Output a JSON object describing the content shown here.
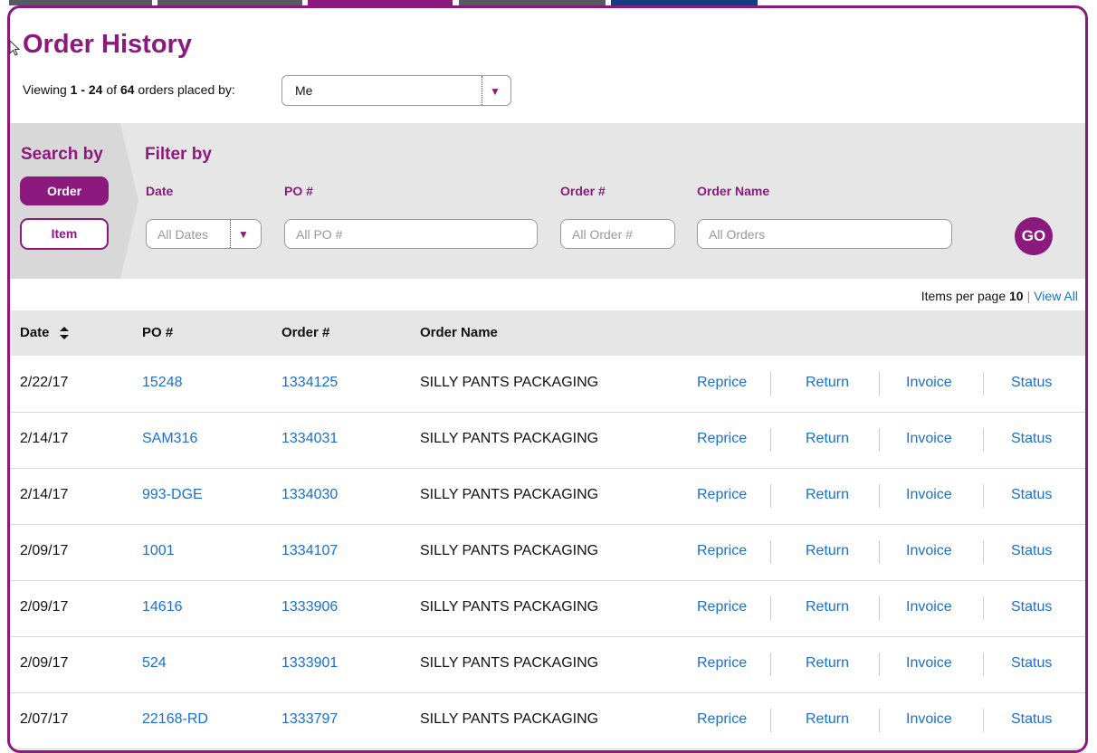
{
  "colors": {
    "accent": "#8c1a7e",
    "link": "#1a6fd1",
    "panel": "#e6e6e6"
  },
  "top_tabs": [
    {
      "color": "#555b63"
    },
    {
      "color": "#555b63"
    },
    {
      "color": "#8c1a7e"
    },
    {
      "color": "#555b63"
    },
    {
      "color": "#123d80"
    }
  ],
  "page": {
    "title": "Order History",
    "viewing_prefix": "Viewing ",
    "viewing_range": "1 - 24",
    "viewing_of": " of ",
    "viewing_total": "64",
    "viewing_suffix": " orders placed by:",
    "placed_by_value": "Me"
  },
  "filters": {
    "search_by_label": "Search by",
    "search_order_label": "Order",
    "search_item_label": "Item",
    "filter_by_label": "Filter by",
    "date_label": "Date",
    "date_placeholder": "All Dates",
    "po_label": "PO #",
    "po_placeholder": "All PO #",
    "order_label": "Order #",
    "order_placeholder": "All Order #",
    "order_name_label": "Order Name",
    "order_name_placeholder": "All Orders",
    "go_label": "GO"
  },
  "pagination": {
    "items_per_page_label": "Items per page",
    "items_per_page_value": "10",
    "view_all_label": "View All"
  },
  "table": {
    "headers": {
      "date": "Date",
      "po": "PO #",
      "order": "Order #",
      "order_name": "Order Name"
    },
    "actions": {
      "reprice": "Reprice",
      "return": "Return",
      "invoice": "Invoice",
      "status": "Status"
    },
    "rows": [
      {
        "date": "2/22/17",
        "po": "15248",
        "order": "1334125",
        "name": "SILLY PANTS PACKAGING"
      },
      {
        "date": "2/14/17",
        "po": "SAM316",
        "order": "1334031",
        "name": "SILLY PANTS PACKAGING"
      },
      {
        "date": "2/14/17",
        "po": "993-DGE",
        "order": "1334030",
        "name": "SILLY PANTS PACKAGING"
      },
      {
        "date": "2/09/17",
        "po": "1001",
        "order": "1334107",
        "name": "SILLY PANTS PACKAGING"
      },
      {
        "date": "2/09/17",
        "po": "14616",
        "order": "1333906",
        "name": "SILLY PANTS PACKAGING"
      },
      {
        "date": "2/09/17",
        "po": "524",
        "order": "1333901",
        "name": "SILLY PANTS PACKAGING"
      },
      {
        "date": "2/07/17",
        "po": "22168-RD",
        "order": "1333797",
        "name": "SILLY PANTS PACKAGING"
      }
    ]
  }
}
